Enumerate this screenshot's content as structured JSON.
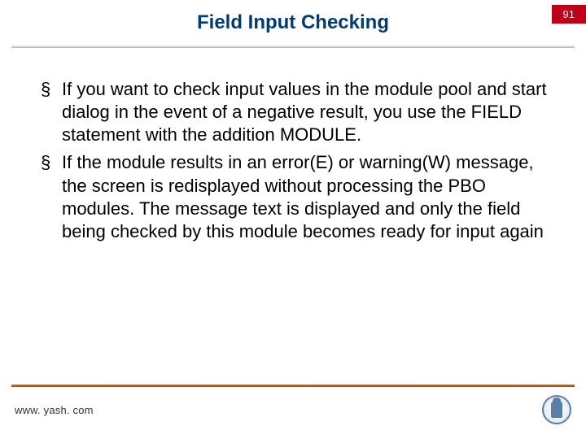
{
  "header": {
    "title": "Field Input Checking",
    "page_number": "91"
  },
  "bullets": [
    "If you want to check input values in the module pool and start dialog in the event of a negative result, you use the FIELD statement with the addition MODULE.",
    "If the module results in an error(E) or warning(W) message, the screen is redisplayed without processing the PBO modules. The message text is displayed and only the field being checked by this module becomes ready for input again"
  ],
  "footer": {
    "url": "www. yash. com"
  }
}
